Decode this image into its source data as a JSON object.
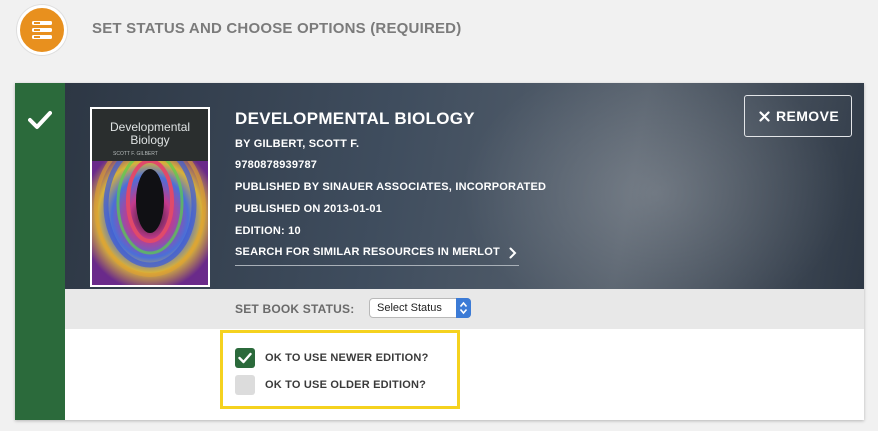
{
  "header": {
    "title": "SET STATUS AND CHOOSE OPTIONS (REQUIRED)",
    "badge_icon": "list-icon",
    "badge_color": "#e8901e"
  },
  "book": {
    "cover": {
      "title_line1": "Developmental",
      "title_line2": "Biology",
      "author": "SCOTT F. GILBERT"
    },
    "title": "DEVELOPMENTAL BIOLOGY",
    "author": "BY GILBERT, SCOTT F.",
    "isbn": "9780878939787",
    "publisher": "PUBLISHED BY SINAUER ASSOCIATES, INCORPORATED",
    "published": "PUBLISHED ON 2013-01-01",
    "edition": "EDITION: 10",
    "search_link": "SEARCH FOR SIMILAR RESOURCES IN MERLOT",
    "status_icon": "checkmark-icon",
    "status_color": "#2b6a3b"
  },
  "remove_button": {
    "label": "REMOVE",
    "icon": "close-icon"
  },
  "status": {
    "label": "SET BOOK STATUS:",
    "select_value": "Select Status",
    "select_accent": "#3c7bd6"
  },
  "options": {
    "highlight_color": "#f5d21f",
    "items": [
      {
        "label": "OK TO USE NEWER EDITION?",
        "checked": true
      },
      {
        "label": "OK TO USE OLDER EDITION?",
        "checked": false
      }
    ]
  }
}
